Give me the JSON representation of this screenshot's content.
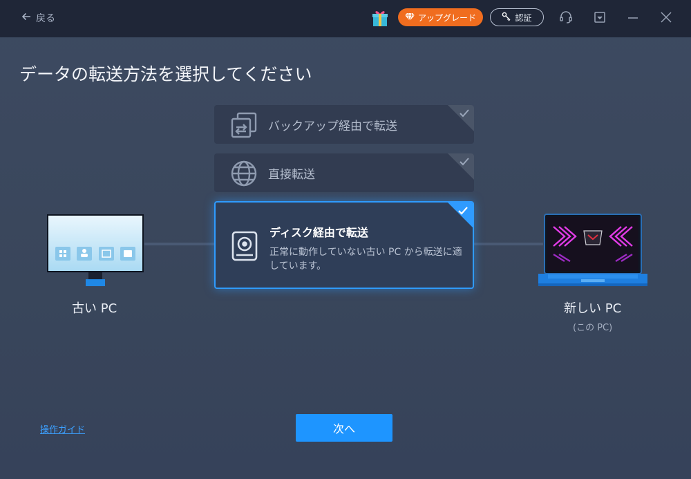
{
  "titlebar": {
    "back_label": "戻る",
    "upgrade_label": "アップグレード",
    "activate_label": "認証"
  },
  "page_title": "データの転送方法を選択してください",
  "methods": [
    {
      "label": "バックアップ経由で転送",
      "icon": "backup-transfer-icon",
      "selected": false
    },
    {
      "label": "直接転送",
      "icon": "globe-icon",
      "selected": false
    },
    {
      "label": "ディスク経由で転送",
      "icon": "disk-icon",
      "selected": true,
      "description": "正常に動作していない古い PC から転送に適しています。"
    }
  ],
  "devices": {
    "old": {
      "label": "古い PC"
    },
    "new": {
      "label": "新しい PC",
      "sublabel": "(この PC)"
    }
  },
  "footer": {
    "guide_link": "操作ガイド",
    "next_label": "次へ"
  },
  "colors": {
    "accent": "#2f9bff",
    "upgrade": "#f06d1f",
    "titlebar": "#1f2637",
    "background": "#3b4860"
  }
}
